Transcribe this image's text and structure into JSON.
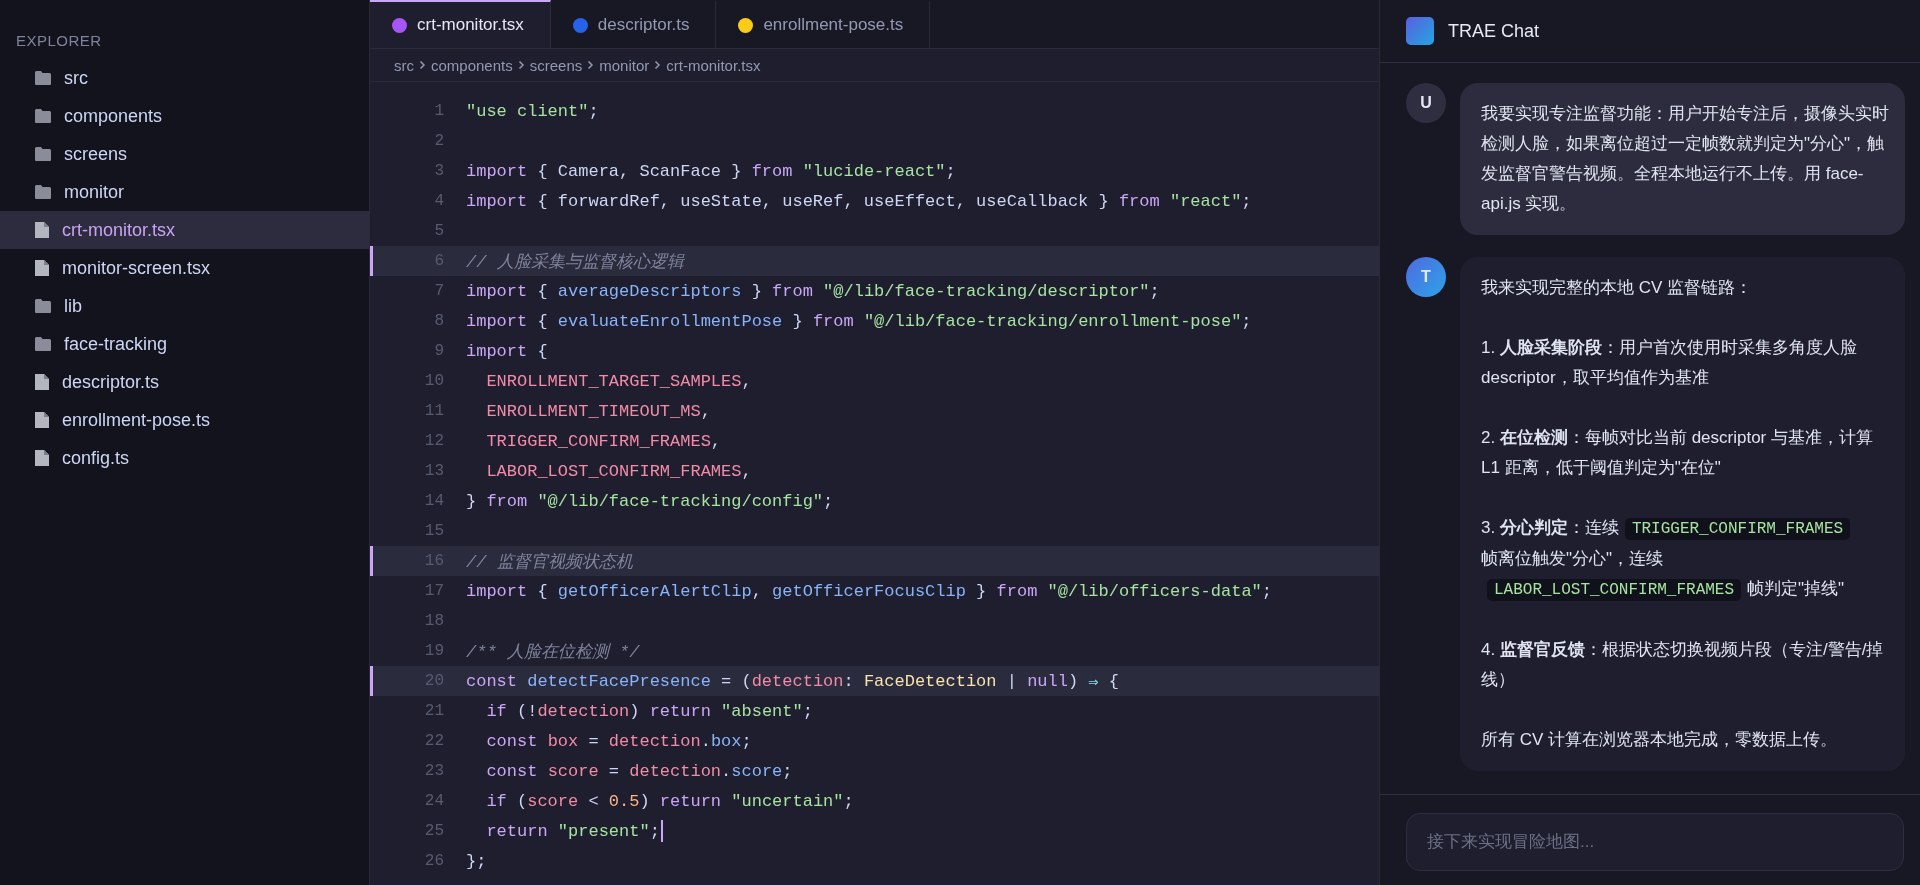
{
  "sidebar": {
    "title": "EXPLORER",
    "items": [
      {
        "label": "src",
        "kind": "folder",
        "selected": false
      },
      {
        "label": "components",
        "kind": "folder",
        "selected": false
      },
      {
        "label": "screens",
        "kind": "folder",
        "selected": false
      },
      {
        "label": "monitor",
        "kind": "folder",
        "selected": false
      },
      {
        "label": "crt-monitor.tsx",
        "kind": "file",
        "selected": true
      },
      {
        "label": "monitor-screen.tsx",
        "kind": "file",
        "selected": false
      },
      {
        "label": "lib",
        "kind": "folder",
        "selected": false
      },
      {
        "label": "face-tracking",
        "kind": "folder",
        "selected": false
      },
      {
        "label": "descriptor.ts",
        "kind": "file",
        "selected": false
      },
      {
        "label": "enrollment-pose.ts",
        "kind": "file",
        "selected": false
      },
      {
        "label": "config.ts",
        "kind": "file",
        "selected": false
      }
    ]
  },
  "tabs": [
    {
      "label": "crt-monitor.tsx",
      "color": "#a855f7",
      "selected": true
    },
    {
      "label": "descriptor.ts",
      "color": "#2563eb",
      "selected": false
    },
    {
      "label": "enrollment-pose.ts",
      "color": "#facc15",
      "selected": false
    }
  ],
  "breadcrumb": [
    "src",
    "components",
    "screens",
    "monitor",
    "crt-monitor.tsx"
  ],
  "code": [
    {
      "number": "1",
      "highlighted": false,
      "tokens": [
        {
          "kind": "string",
          "text": "\"use client\""
        },
        {
          "kind": "plain",
          "text": ";"
        }
      ]
    },
    {
      "number": "2",
      "highlighted": false
    },
    {
      "number": "3",
      "highlighted": false,
      "tokens": [
        {
          "kind": "keyword",
          "text": "import"
        },
        {
          "kind": "plain",
          "text": " { Camera, ScanFace } "
        },
        {
          "kind": "keyword",
          "text": "from "
        },
        {
          "kind": "string",
          "text": "\"lucide-react\""
        },
        {
          "kind": "plain",
          "text": ";"
        }
      ]
    },
    {
      "number": "4",
      "highlighted": false,
      "tokens": [
        {
          "kind": "keyword",
          "text": "import"
        },
        {
          "kind": "plain",
          "text": " { forwardRef, useState, useRef, useEffect, useCallback } "
        },
        {
          "kind": "keyword",
          "text": "from "
        },
        {
          "kind": "string",
          "text": "\"react\""
        },
        {
          "kind": "plain",
          "text": ";"
        }
      ]
    },
    {
      "number": "5",
      "highlighted": false
    },
    {
      "number": "6",
      "highlighted": true,
      "tokens": [
        {
          "kind": "comment",
          "text": "// 人脸采集与监督核心逻辑"
        }
      ]
    },
    {
      "number": "7",
      "highlighted": false,
      "tokens": [
        {
          "kind": "keyword",
          "text": "import"
        },
        {
          "kind": "plain",
          "text": " { "
        },
        {
          "kind": "function",
          "text": "averageDescriptors"
        },
        {
          "kind": "plain",
          "text": " } "
        },
        {
          "kind": "keyword",
          "text": "from "
        },
        {
          "kind": "string",
          "text": "\"@/lib/face-tracking/descriptor\""
        },
        {
          "kind": "plain",
          "text": ";"
        }
      ]
    },
    {
      "number": "8",
      "highlighted": false,
      "tokens": [
        {
          "kind": "keyword",
          "text": "import"
        },
        {
          "kind": "plain",
          "text": " { "
        },
        {
          "kind": "function",
          "text": "evaluateEnrollmentPose"
        },
        {
          "kind": "plain",
          "text": " } "
        },
        {
          "kind": "keyword",
          "text": "from "
        },
        {
          "kind": "string",
          "text": "\"@/lib/face-tracking/enrollment-pose\""
        },
        {
          "kind": "plain",
          "text": ";"
        }
      ]
    },
    {
      "number": "9",
      "highlighted": false,
      "tokens": [
        {
          "kind": "keyword",
          "text": "import"
        },
        {
          "kind": "plain",
          "text": " {"
        }
      ]
    },
    {
      "number": "10",
      "highlighted": false,
      "tokens": [
        {
          "kind": "constant",
          "text": "  ENROLLMENT_TARGET_SAMPLES"
        },
        {
          "kind": "plain",
          "text": ","
        }
      ]
    },
    {
      "number": "11",
      "highlighted": false,
      "tokens": [
        {
          "kind": "constant",
          "text": "  ENROLLMENT_TIMEOUT_MS"
        },
        {
          "kind": "plain",
          "text": ","
        }
      ]
    },
    {
      "number": "12",
      "highlighted": false,
      "tokens": [
        {
          "kind": "constant",
          "text": "  TRIGGER_CONFIRM_FRAMES"
        },
        {
          "kind": "plain",
          "text": ","
        }
      ]
    },
    {
      "number": "13",
      "highlighted": false,
      "tokens": [
        {
          "kind": "constant",
          "text": "  LABOR_LOST_CONFIRM_FRAMES"
        },
        {
          "kind": "plain",
          "text": ","
        }
      ]
    },
    {
      "number": "14",
      "highlighted": false,
      "tokens": [
        {
          "kind": "plain",
          "text": "} "
        },
        {
          "kind": "keyword",
          "text": "from "
        },
        {
          "kind": "string",
          "text": "\"@/lib/face-tracking/config\""
        },
        {
          "kind": "plain",
          "text": ";"
        }
      ]
    },
    {
      "number": "15",
      "highlighted": false
    },
    {
      "number": "16",
      "highlighted": true,
      "tokens": [
        {
          "kind": "comment",
          "text": "// 监督官视频状态机"
        }
      ]
    },
    {
      "number": "17",
      "highlighted": false,
      "tokens": [
        {
          "kind": "keyword",
          "text": "import"
        },
        {
          "kind": "plain",
          "text": " { "
        },
        {
          "kind": "function",
          "text": "getOfficerAlertClip"
        },
        {
          "kind": "plain",
          "text": ", "
        },
        {
          "kind": "function",
          "text": "getOfficerFocusClip"
        },
        {
          "kind": "plain",
          "text": " } "
        },
        {
          "kind": "keyword",
          "text": "from "
        },
        {
          "kind": "string",
          "text": "\"@/lib/officers-data\""
        },
        {
          "kind": "plain",
          "text": ";"
        }
      ]
    },
    {
      "number": "18",
      "highlighted": false
    },
    {
      "number": "19",
      "highlighted": false,
      "tokens": [
        {
          "kind": "comment",
          "text": "/** 人脸在位检测 */"
        }
      ]
    },
    {
      "number": "20",
      "highlighted": true,
      "tokens": [
        {
          "kind": "keyword",
          "text": "const "
        },
        {
          "kind": "function",
          "text": "detectFacePresence"
        },
        {
          "kind": "plain",
          "text": " = ("
        },
        {
          "kind": "param",
          "text": "detection"
        },
        {
          "kind": "plain",
          "text": ": "
        },
        {
          "kind": "type",
          "text": "FaceDetection"
        },
        {
          "kind": "plain",
          "text": " | "
        },
        {
          "kind": "keyword",
          "text": "null"
        },
        {
          "kind": "plain",
          "text": ") "
        },
        {
          "kind": "operator",
          "text": "⇒"
        },
        {
          "kind": "plain",
          "text": " {"
        }
      ]
    },
    {
      "number": "21",
      "highlighted": false,
      "tokens": [
        {
          "kind": "keyword",
          "text": "  if"
        },
        {
          "kind": "plain",
          "text": " (!"
        },
        {
          "kind": "param",
          "text": "detection"
        },
        {
          "kind": "plain",
          "text": ") "
        },
        {
          "kind": "keyword",
          "text": "return "
        },
        {
          "kind": "string",
          "text": "\"absent\""
        },
        {
          "kind": "plain",
          "text": ";"
        }
      ]
    },
    {
      "number": "22",
      "highlighted": false,
      "tokens": [
        {
          "kind": "keyword",
          "text": "  const "
        },
        {
          "kind": "param",
          "text": "box"
        },
        {
          "kind": "plain",
          "text": " = "
        },
        {
          "kind": "param",
          "text": "detection"
        },
        {
          "kind": "plain",
          "text": "."
        },
        {
          "kind": "function",
          "text": "box"
        },
        {
          "kind": "plain",
          "text": ";"
        }
      ]
    },
    {
      "number": "23",
      "highlighted": false,
      "tokens": [
        {
          "kind": "keyword",
          "text": "  const "
        },
        {
          "kind": "param",
          "text": "score"
        },
        {
          "kind": "plain",
          "text": " = "
        },
        {
          "kind": "param",
          "text": "detection"
        },
        {
          "kind": "plain",
          "text": "."
        },
        {
          "kind": "function",
          "text": "score"
        },
        {
          "kind": "plain",
          "text": ";"
        }
      ]
    },
    {
      "number": "24",
      "highlighted": false,
      "tokens": [
        {
          "kind": "keyword",
          "text": "  if"
        },
        {
          "kind": "plain",
          "text": " ("
        },
        {
          "kind": "param",
          "text": "score"
        },
        {
          "kind": "plain",
          "text": " < "
        },
        {
          "kind": "number",
          "text": "0.5"
        },
        {
          "kind": "plain",
          "text": ") "
        },
        {
          "kind": "keyword",
          "text": "return "
        },
        {
          "kind": "string",
          "text": "\"uncertain\""
        },
        {
          "kind": "plain",
          "text": ";"
        }
      ]
    },
    {
      "number": "25",
      "highlighted": false,
      "cursor": true,
      "tokens": [
        {
          "kind": "keyword",
          "text": "  return "
        },
        {
          "kind": "string",
          "text": "\"present\""
        },
        {
          "kind": "plain",
          "text": ";"
        }
      ]
    },
    {
      "number": "26",
      "highlighted": false,
      "tokens": [
        {
          "kind": "plain",
          "text": "};"
        }
      ]
    }
  ],
  "chat": {
    "title": "TRAE Chat",
    "messages": [
      {
        "kind": "user",
        "avatar": "U",
        "paragraphs": [
          [
            {
              "kind": "text",
              "text": "我要实现专注监督功能：用户开始专注后，摄像头实时检测人脸，如果离位超过一定帧数就判定为\"分心\"，触发监督官警告视频。全程本地运行不上传。用 face-api.js 实现。"
            }
          ]
        ]
      },
      {
        "kind": "assistant",
        "avatar": "T",
        "paragraphs": [
          [
            {
              "kind": "text",
              "text": "我来实现完整的本地 CV 监督链路："
            }
          ],
          [
            {
              "kind": "text",
              "text": "1. **人脸采集阶段**：用户首次使用时采集多角度人脸 descriptor，取平均值作为基准"
            }
          ],
          [
            {
              "kind": "text",
              "text": "2. **在位检测**：每帧对比当前 descriptor 与基准，计算 L1 距离，低于阈值判定为\"在位\""
            }
          ],
          [
            {
              "kind": "text",
              "text": "3. **分心判定**：连续"
            },
            {
              "kind": "code",
              "text": "TRIGGER_CONFIRM_FRAMES"
            },
            {
              "kind": "text",
              "text": "帧离位触发\"分心\"，连续"
            },
            {
              "kind": "code",
              "text": "LABOR_LOST_CONFIRM_FRAMES"
            },
            {
              "kind": "text",
              "text": "帧判定\"掉线\""
            }
          ],
          [
            {
              "kind": "text",
              "text": "4. **监督官反馈**：根据状态切换视频片段（专注/警告/掉线）"
            }
          ],
          [
            {
              "kind": "text",
              "text": "所有 CV 计算在浏览器本地完成，零数据上传。"
            }
          ]
        ]
      }
    ],
    "input": {
      "placeholder": "接下来实现冒险地图..."
    }
  }
}
